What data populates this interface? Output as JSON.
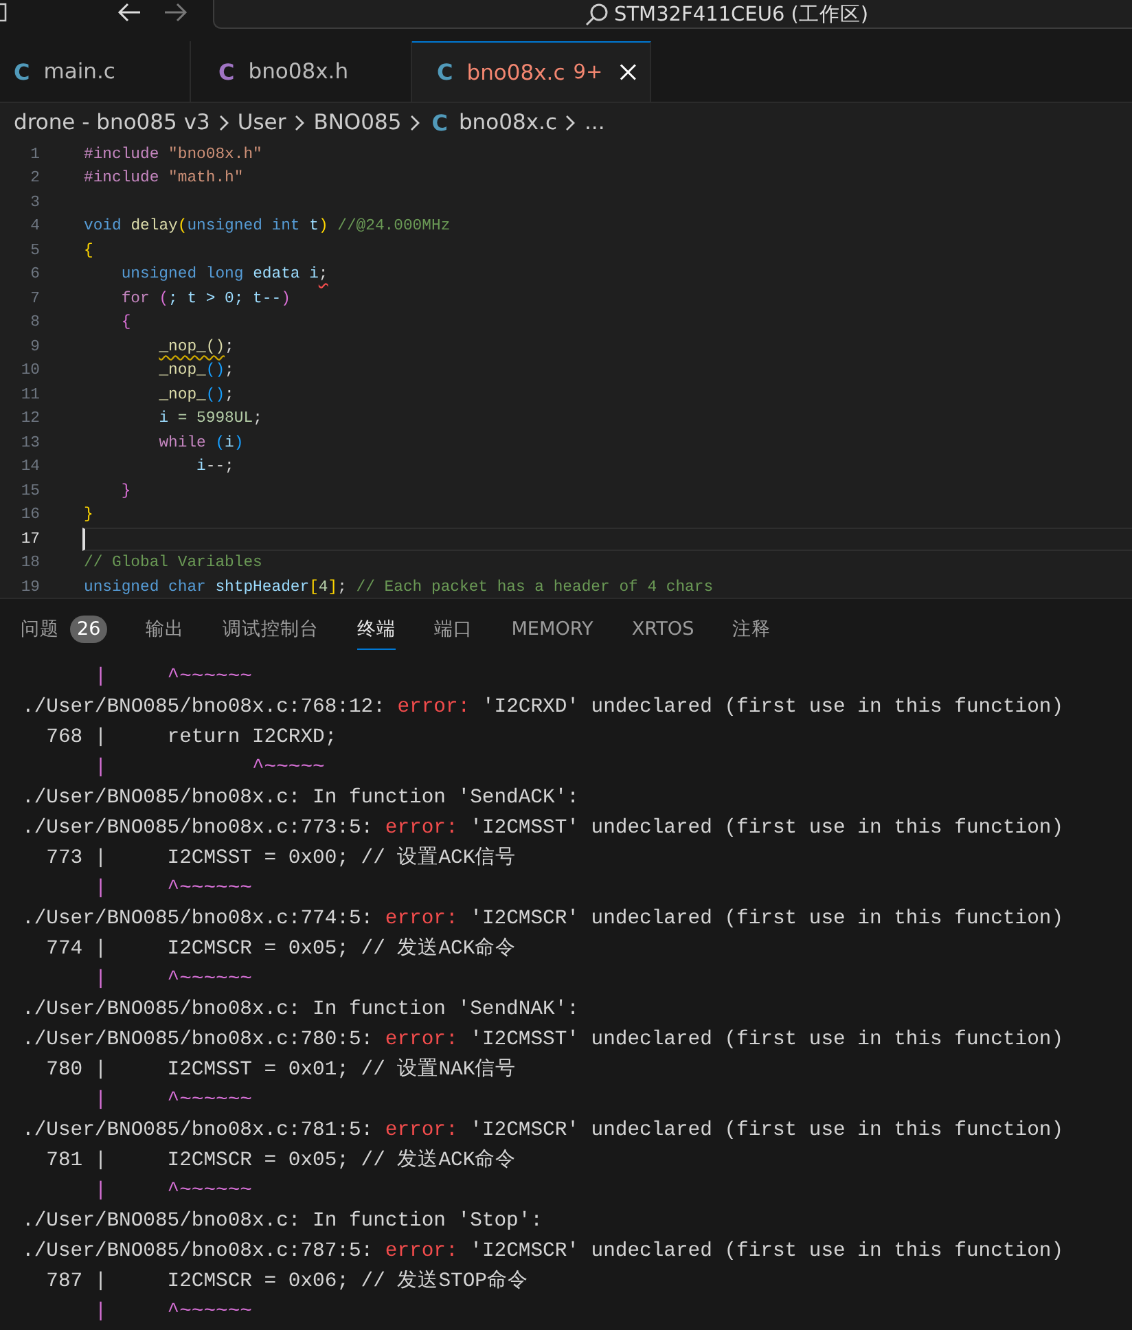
{
  "titlebar": {
    "search": "STM32F411CEU6 (工作区)"
  },
  "tabs": [
    {
      "label": "main.c",
      "icon": "C",
      "color": "#519aba",
      "selected": false
    },
    {
      "label": "bno08x.h",
      "icon": "C",
      "color": "#a074c4",
      "selected": false
    },
    {
      "label": "bno08x.c",
      "icon": "C",
      "color": "#519aba",
      "selected": true,
      "badge": "9+"
    }
  ],
  "breadcrumb": [
    {
      "label": "drone - bno085 v3"
    },
    {
      "label": "User"
    },
    {
      "label": "BNO085"
    },
    {
      "label": "bno08x.c",
      "icon": "C"
    },
    {
      "label": "..."
    }
  ],
  "code": [
    {
      "number": "1",
      "spans": [
        {
          "text": "#include ",
          "kind": "control"
        },
        {
          "text": "\"bno08x.h\"",
          "kind": "str"
        }
      ]
    },
    {
      "number": "2",
      "spans": [
        {
          "text": "#include ",
          "kind": "control"
        },
        {
          "text": "\"math.h\"",
          "kind": "str"
        }
      ]
    },
    {
      "number": "3"
    },
    {
      "number": "4",
      "spans": [
        {
          "text": "void ",
          "kind": "kw"
        },
        {
          "text": "delay",
          "kind": "func"
        },
        {
          "text": "(",
          "kind": "b1"
        },
        {
          "text": "unsigned int",
          "kind": "kw"
        },
        {
          "text": " t",
          "kind": "var"
        },
        {
          "text": ")",
          "kind": "b1"
        },
        {
          "text": " //@24.000MHz",
          "kind": "comment"
        }
      ]
    },
    {
      "number": "5",
      "spans": [
        {
          "text": "{",
          "kind": "b1"
        }
      ]
    },
    {
      "number": "6",
      "spans": [
        {
          "text": "    unsigned long",
          "kind": "kw"
        },
        {
          "text": " edata i",
          "kind": "var"
        },
        {
          "text": ";",
          "kind": "plain",
          "has_error": true
        }
      ]
    },
    {
      "number": "7",
      "spans": [
        {
          "text": "    for ",
          "kind": "control"
        },
        {
          "text": "(",
          "kind": "b2"
        },
        {
          "text": "; t > 0; t--",
          "kind": "var"
        },
        {
          "text": ")",
          "kind": "b2"
        }
      ]
    },
    {
      "number": "8",
      "spans": [
        {
          "text": "    {",
          "kind": "b2"
        }
      ]
    },
    {
      "number": "9",
      "spans": [
        {
          "text": "        _nop_()",
          "kind": "func",
          "has_warning": true
        },
        {
          "text": ";",
          "kind": "plain"
        }
      ]
    },
    {
      "number": "10",
      "spans": [
        {
          "text": "        _nop_",
          "kind": "func"
        },
        {
          "text": "()",
          "kind": "b3"
        },
        {
          "text": ";",
          "kind": "plain"
        }
      ]
    },
    {
      "number": "11",
      "spans": [
        {
          "text": "        _nop_",
          "kind": "func"
        },
        {
          "text": "()",
          "kind": "b3"
        },
        {
          "text": ";",
          "kind": "plain"
        }
      ]
    },
    {
      "number": "12",
      "spans": [
        {
          "text": "        i",
          "kind": "var"
        },
        {
          "text": " = 5998UL",
          "kind": "num"
        },
        {
          "text": ";",
          "kind": "plain"
        }
      ]
    },
    {
      "number": "13",
      "spans": [
        {
          "text": "        while ",
          "kind": "control"
        },
        {
          "text": "(",
          "kind": "b3"
        },
        {
          "text": "i",
          "kind": "var"
        },
        {
          "text": ")",
          "kind": "b3"
        }
      ]
    },
    {
      "number": "14",
      "spans": [
        {
          "text": "            i",
          "kind": "var"
        },
        {
          "text": "--;",
          "kind": "plain"
        }
      ]
    },
    {
      "number": "15",
      "spans": [
        {
          "text": "    }",
          "kind": "b2"
        }
      ]
    },
    {
      "number": "16",
      "spans": [
        {
          "text": "}",
          "kind": "b1"
        }
      ]
    },
    {
      "number": "17",
      "current": true
    },
    {
      "number": "18",
      "spans": [
        {
          "text": "// Global Variables",
          "kind": "comment"
        }
      ]
    },
    {
      "number": "19",
      "spans": [
        {
          "text": "unsigned char",
          "kind": "kw"
        },
        {
          "text": " shtpHeader",
          "kind": "var"
        },
        {
          "text": "[",
          "kind": "b1"
        },
        {
          "text": "4",
          "kind": "num"
        },
        {
          "text": "]",
          "kind": "b1"
        },
        {
          "text": ";",
          "kind": "plain"
        },
        {
          "text": " // Each packet has a header of 4 chars",
          "kind": "comment"
        }
      ]
    }
  ],
  "panel_tabs": [
    {
      "label": "问题",
      "badge": "26",
      "selected": false
    },
    {
      "label": "输出",
      "selected": false
    },
    {
      "label": "调试控制台",
      "selected": false
    },
    {
      "label": "终端",
      "selected": true
    },
    {
      "label": "端口",
      "selected": false
    },
    {
      "label": "MEMORY",
      "selected": false
    },
    {
      "label": "XRTOS",
      "selected": false
    },
    {
      "label": "注释",
      "selected": false
    }
  ],
  "terminal": [
    {
      "spans": [
        {
          "text": "      |",
          "kind": "pipe"
        },
        {
          "text": "     ^~~~~~~",
          "kind": "caret"
        }
      ]
    },
    {
      "spans": [
        {
          "text": "./User/BNO085/bno08x.c:768:12: ",
          "kind": "plain"
        },
        {
          "text": "error:",
          "kind": "error"
        },
        {
          "text": " 'I2CRXD' undeclared (first use in this function)",
          "kind": "plain"
        }
      ]
    },
    {
      "spans": [
        {
          "text": "  768 |     return I2CRXD;",
          "kind": "plain"
        }
      ]
    },
    {
      "spans": [
        {
          "text": "      |",
          "kind": "pipe"
        },
        {
          "text": "            ^~~~~~",
          "kind": "caret"
        }
      ]
    },
    {
      "spans": [
        {
          "text": "./User/BNO085/bno08x.c: In function 'SendACK':",
          "kind": "plain"
        }
      ]
    },
    {
      "spans": [
        {
          "text": "./User/BNO085/bno08x.c:773:5: ",
          "kind": "plain"
        },
        {
          "text": "error:",
          "kind": "error"
        },
        {
          "text": " 'I2CMSST' undeclared (first use in this function)",
          "kind": "plain"
        }
      ]
    },
    {
      "spans": [
        {
          "text": "  773 |     I2CMSST = 0x00; // 设置ACK信号",
          "kind": "plain"
        }
      ]
    },
    {
      "spans": [
        {
          "text": "      |",
          "kind": "pipe"
        },
        {
          "text": "     ^~~~~~~",
          "kind": "caret"
        }
      ]
    },
    {
      "spans": [
        {
          "text": "./User/BNO085/bno08x.c:774:5: ",
          "kind": "plain"
        },
        {
          "text": "error:",
          "kind": "error"
        },
        {
          "text": " 'I2CMSCR' undeclared (first use in this function)",
          "kind": "plain"
        }
      ]
    },
    {
      "spans": [
        {
          "text": "  774 |     I2CMSCR = 0x05; // 发送ACK命令",
          "kind": "plain"
        }
      ]
    },
    {
      "spans": [
        {
          "text": "      |",
          "kind": "pipe"
        },
        {
          "text": "     ^~~~~~~",
          "kind": "caret"
        }
      ]
    },
    {
      "spans": [
        {
          "text": "./User/BNO085/bno08x.c: In function 'SendNAK':",
          "kind": "plain"
        }
      ]
    },
    {
      "spans": [
        {
          "text": "./User/BNO085/bno08x.c:780:5: ",
          "kind": "plain"
        },
        {
          "text": "error:",
          "kind": "error"
        },
        {
          "text": " 'I2CMSST' undeclared (first use in this function)",
          "kind": "plain"
        }
      ]
    },
    {
      "spans": [
        {
          "text": "  780 |     I2CMSST = 0x01; // 设置NAK信号",
          "kind": "plain"
        }
      ]
    },
    {
      "spans": [
        {
          "text": "      |",
          "kind": "pipe"
        },
        {
          "text": "     ^~~~~~~",
          "kind": "caret"
        }
      ]
    },
    {
      "spans": [
        {
          "text": "./User/BNO085/bno08x.c:781:5: ",
          "kind": "plain"
        },
        {
          "text": "error:",
          "kind": "error"
        },
        {
          "text": " 'I2CMSCR' undeclared (first use in this function)",
          "kind": "plain"
        }
      ]
    },
    {
      "spans": [
        {
          "text": "  781 |     I2CMSCR = 0x05; // 发送ACK命令",
          "kind": "plain"
        }
      ]
    },
    {
      "spans": [
        {
          "text": "      |",
          "kind": "pipe"
        },
        {
          "text": "     ^~~~~~~",
          "kind": "caret"
        }
      ]
    },
    {
      "spans": [
        {
          "text": "./User/BNO085/bno08x.c: In function 'Stop':",
          "kind": "plain"
        }
      ]
    },
    {
      "spans": [
        {
          "text": "./User/BNO085/bno08x.c:787:5: ",
          "kind": "plain"
        },
        {
          "text": "error:",
          "kind": "error"
        },
        {
          "text": " 'I2CMSCR' undeclared (first use in this function)",
          "kind": "plain"
        }
      ]
    },
    {
      "spans": [
        {
          "text": "  787 |     I2CMSCR = 0x06; // 发送STOP命令",
          "kind": "plain"
        }
      ]
    },
    {
      "spans": [
        {
          "text": "      |",
          "kind": "pipe"
        },
        {
          "text": "     ^~~~~~~",
          "kind": "caret"
        }
      ]
    }
  ]
}
